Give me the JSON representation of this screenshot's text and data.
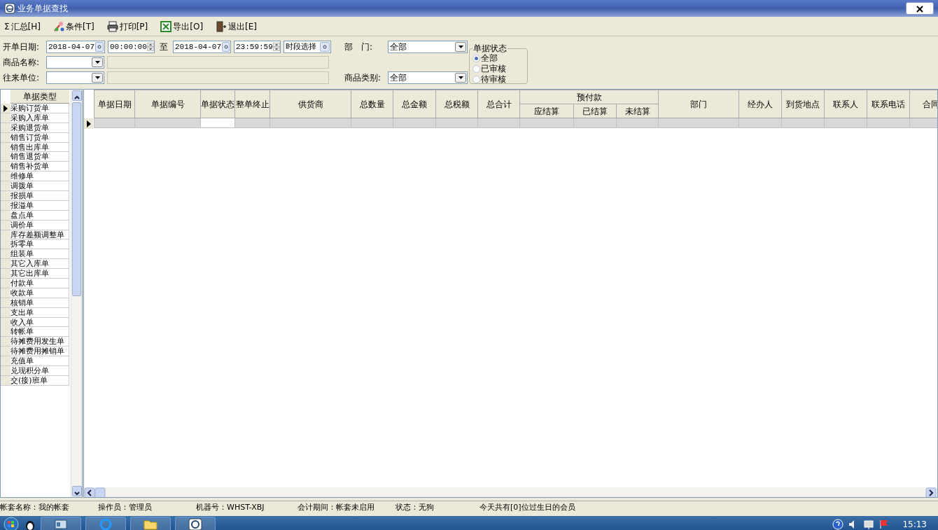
{
  "window": {
    "title": "业务单据查找"
  },
  "toolbar": [
    {
      "kind": "sigma",
      "glyph": "Σ",
      "label": "汇总[H]"
    },
    {
      "kind": "filter",
      "label": "条件[T]"
    },
    {
      "kind": "print",
      "label": "打印[P]"
    },
    {
      "kind": "excel",
      "label": "导出[O]"
    },
    {
      "kind": "exit",
      "label": "退出[E]"
    }
  ],
  "filters": {
    "date_label": "开单日期:",
    "date_from": "2018-04-07",
    "time_from": "00:00:00",
    "to_label": "至",
    "date_to": "2018-04-07",
    "time_to": "23:59:59",
    "period": "时段选择",
    "product_label": "商品名称:",
    "partner_label": "往来单位:",
    "dept_label": "部　门:",
    "dept_value": "全部",
    "category_label": "商品类别:",
    "category_value": "全部"
  },
  "status_group": {
    "title": "单据状态",
    "options": [
      {
        "label": "全部",
        "selected": true
      },
      {
        "label": "已审核",
        "selected": false
      },
      {
        "label": "待审核",
        "selected": false
      }
    ]
  },
  "doc_types": {
    "header": "单据类型",
    "items": [
      {
        "label": "采购订货单",
        "selected": true
      },
      {
        "label": "采购入库单",
        "selected": false
      },
      {
        "label": "采购退货单",
        "selected": false
      },
      {
        "label": "销售订货单",
        "selected": false
      },
      {
        "label": "销售出库单",
        "selected": false
      },
      {
        "label": "销售退货单",
        "selected": false
      },
      {
        "label": "销售补货单",
        "selected": false
      },
      {
        "label": "维修单",
        "selected": false
      },
      {
        "label": "调拨单",
        "selected": false
      },
      {
        "label": "报损单",
        "selected": false
      },
      {
        "label": "报溢单",
        "selected": false
      },
      {
        "label": "盘点单",
        "selected": false
      },
      {
        "label": "调价单",
        "selected": false
      },
      {
        "label": "库存差额调整单",
        "selected": false
      },
      {
        "label": "拆零单",
        "selected": false
      },
      {
        "label": "组装单",
        "selected": false
      },
      {
        "label": "其它入库单",
        "selected": false
      },
      {
        "label": "其它出库单",
        "selected": false
      },
      {
        "label": "付款单",
        "selected": false
      },
      {
        "label": "收款单",
        "selected": false
      },
      {
        "label": "核销单",
        "selected": false
      },
      {
        "label": "支出单",
        "selected": false
      },
      {
        "label": "收入单",
        "selected": false
      },
      {
        "label": "转帐单",
        "selected": false
      },
      {
        "label": "待摊费用发生单",
        "selected": false
      },
      {
        "label": "待摊费用摊销单",
        "selected": false
      },
      {
        "label": "充值单",
        "selected": false
      },
      {
        "label": "兑现积分单",
        "selected": false
      },
      {
        "label": "交(接)班单",
        "selected": false
      }
    ]
  },
  "grid": {
    "columns": [
      {
        "label": "单据日期"
      },
      {
        "label": "单据编号"
      },
      {
        "label": "单据状态"
      },
      {
        "label": "整单终止"
      },
      {
        "label": "供货商"
      },
      {
        "label": "总数量"
      },
      {
        "label": "总金额"
      },
      {
        "label": "总税额"
      },
      {
        "label": "总合计"
      },
      {
        "label": "预付款",
        "children": [
          {
            "label": "应结算"
          },
          {
            "label": "已结算"
          },
          {
            "label": "未结算"
          }
        ]
      },
      {
        "label": "部门"
      },
      {
        "label": "经办人"
      },
      {
        "label": "到货地点"
      },
      {
        "label": "联系人"
      },
      {
        "label": "联系电话"
      },
      {
        "label": "合同"
      }
    ],
    "rows": [
      {
        "current": true
      }
    ]
  },
  "status_bar": [
    "帐套名称：我的帐套",
    "操作员：管理员",
    "机器号：WHST-XBJ",
    "会计期间：帐套未启用",
    "状态：无狗",
    "今天共有[0]位过生日的会员"
  ],
  "taskbar": {
    "clock": "15:13"
  }
}
